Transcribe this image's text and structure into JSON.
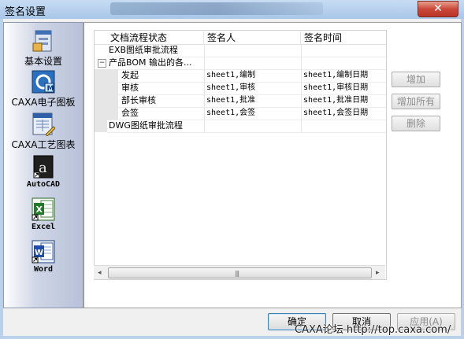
{
  "window": {
    "title": "签名设置",
    "close_glyph": "✕"
  },
  "nav": {
    "items": [
      {
        "label": "基本设置",
        "icon": "settings-window-icon"
      },
      {
        "label": "CAXA电子图板",
        "icon": "caxa-draft-icon"
      },
      {
        "label": "CAXA工艺图表",
        "icon": "caxa-process-icon"
      },
      {
        "label": "AutoCAD",
        "icon": "autocad-icon"
      },
      {
        "label": "Excel",
        "icon": "excel-icon"
      },
      {
        "label": "Word",
        "icon": "word-icon"
      }
    ]
  },
  "table": {
    "headers": [
      "文档流程状态",
      "签名人",
      "签名时间"
    ],
    "rows": [
      {
        "name": "EXB图纸审批流程",
        "signer": "",
        "time": ""
      },
      {
        "name": "产品BOM 输出的各...",
        "signer": "",
        "time": "",
        "expander": "−"
      },
      {
        "name": "发起",
        "signer": "sheet1,编制",
        "time": "sheet1,编制日期"
      },
      {
        "name": "审核",
        "signer": "sheet1,审核",
        "time": "sheet1,审核日期"
      },
      {
        "name": "部长审核",
        "signer": "sheet1,批准",
        "time": "sheet1,批准日期"
      },
      {
        "name": "会签",
        "signer": "sheet1,会签",
        "time": "sheet1,会签日期"
      },
      {
        "name": "DWG图纸审批流程",
        "signer": "",
        "time": ""
      }
    ]
  },
  "scrollbar": {
    "left_arrow": "◂",
    "right_arrow": "▸",
    "grip": "|||"
  },
  "side_buttons": {
    "add": "增加",
    "add_all": "增加所有",
    "delete": "删除"
  },
  "bottom_buttons": {
    "ok": "确定",
    "cancel": "取消",
    "apply": "应用(A)"
  },
  "watermark": "CAXA论坛 http://top.caxa.com/"
}
